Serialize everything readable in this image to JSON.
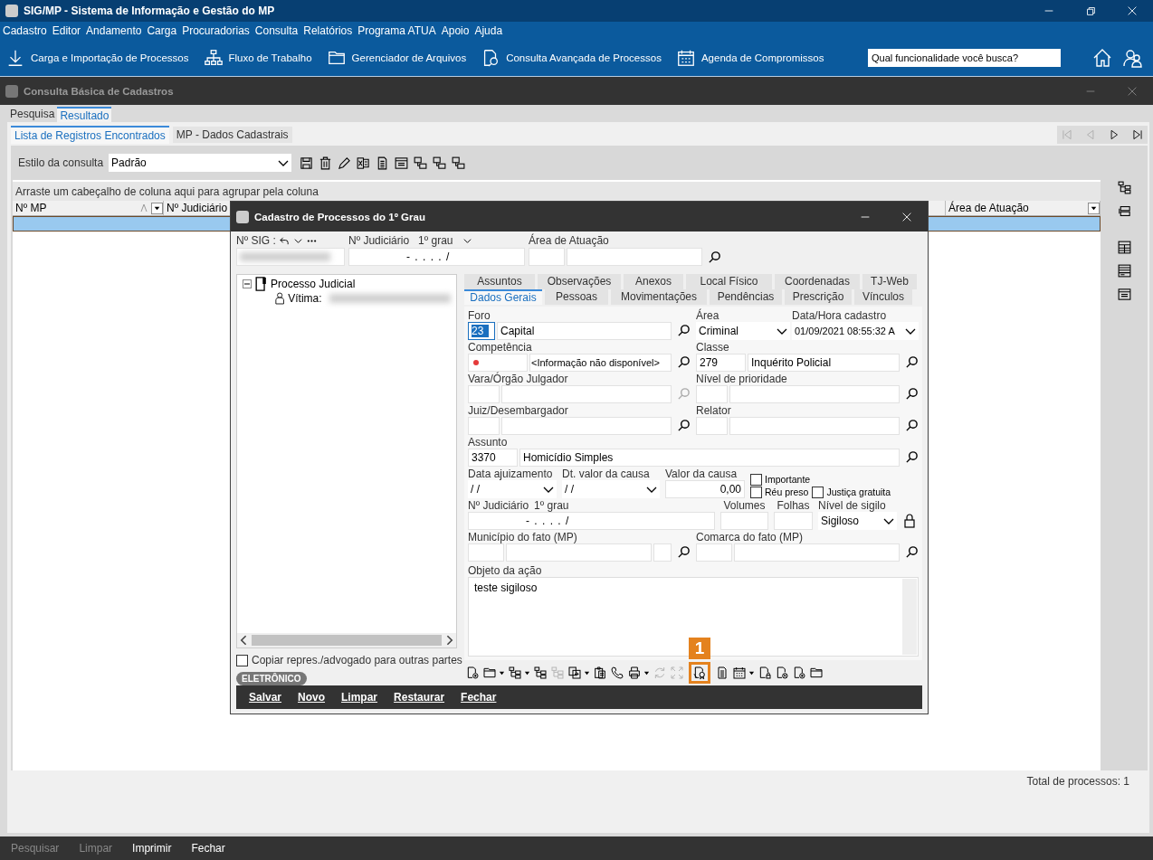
{
  "app": {
    "title": "SIG/MP - Sistema de Informação e Gestão do MP"
  },
  "menu": [
    "Cadastro",
    "Editor",
    "Andamento",
    "Carga",
    "Procuradorias",
    "Consulta",
    "Relatórios",
    "Programa ATUA",
    "Apoio",
    "Ajuda"
  ],
  "toolbar": [
    {
      "kind": "download",
      "label": "Carga e Importação de Processos"
    },
    {
      "kind": "orgchart",
      "label": "Fluxo de Trabalho"
    },
    {
      "kind": "folder",
      "label": "Gerenciador de Arquivos"
    },
    {
      "kind": "docsearch",
      "label": "Consulta Avançada de Processos"
    },
    {
      "kind": "calendar",
      "label": "Agenda de Compromissos"
    }
  ],
  "search": {
    "placeholder": "Qual funcionalidade você busca?"
  },
  "child_window": {
    "title": "Consulta Básica de Cadastros"
  },
  "tabs": [
    {
      "label": "Pesquisa",
      "selected": false
    },
    {
      "label": "Resultado",
      "selected": true
    }
  ],
  "subtabs": [
    {
      "label": "Lista de Registros Encontrados",
      "selected": true
    },
    {
      "label": "MP - Dados Cadastrais",
      "selected": false
    }
  ],
  "pager": [
    {
      "kind": "first",
      "disabled": true
    },
    {
      "kind": "prev",
      "disabled": true
    },
    {
      "kind": "next",
      "disabled": false
    },
    {
      "kind": "last",
      "disabled": false
    }
  ],
  "query_style": {
    "label": "Estilo da consulta",
    "value": "Padrão"
  },
  "style_tools": [
    {
      "kind": "save"
    },
    {
      "kind": "trash"
    },
    {
      "kind": "pencil"
    },
    {
      "kind": "sheet"
    },
    {
      "kind": "doc"
    },
    {
      "kind": "window"
    },
    {
      "kind": "network"
    },
    {
      "kind": "network"
    },
    {
      "kind": "network"
    }
  ],
  "group_hint": "Arraste um cabeçalho de coluna aqui para agrupar pela coluna",
  "columns": [
    {
      "label": "Nº MP",
      "sorted": true,
      "filter": true
    },
    {
      "label": "Nº Judiciário"
    },
    {
      "label": "Área de Atuação",
      "sorted": false,
      "filter": true
    }
  ],
  "grid_rows": [
    {
      "selected": true
    }
  ],
  "side_tools": [
    {
      "kind": "tree"
    },
    {
      "kind": "layers"
    },
    {
      "kind": "table"
    },
    {
      "kind": "list"
    },
    {
      "kind": "window"
    }
  ],
  "total": "Total de processos: 1",
  "bottom_actions": [
    {
      "label": "Pesquisar",
      "disabled": true
    },
    {
      "label": "Limpar",
      "disabled": true
    },
    {
      "label": "Imprimir",
      "disabled": false
    },
    {
      "label": "Fechar",
      "disabled": false
    }
  ],
  "dialog": {
    "title": "Cadastro de Processos do 1º Grau",
    "sig_label": "Nº SIG :",
    "jud_label": "Nº Judiciário",
    "jud_grade": "1º grau",
    "jud_value": "- .  . . .  /",
    "area_label": "Área de Atuação",
    "tree": [
      {
        "label": "Processo Judicial",
        "expanded": true,
        "children": [
          {
            "label": "Vítima:"
          }
        ]
      }
    ],
    "copy_option": {
      "label": "Copiar repres./advogado para outras partes",
      "checked": false
    },
    "badge": "ELETRÔNICO",
    "tabs_top": [
      {
        "label": "Assuntos"
      },
      {
        "label": "Observações"
      },
      {
        "label": "Anexos"
      },
      {
        "label": "Local Físico"
      },
      {
        "label": "Coordenadas"
      },
      {
        "label": "TJ-Web"
      }
    ],
    "tabs": [
      {
        "label": "Dados Gerais",
        "selected": true
      },
      {
        "label": "Pessoas",
        "selected": false
      },
      {
        "label": "Movimentações",
        "selected": false
      },
      {
        "label": "Pendências",
        "selected": false
      },
      {
        "label": "Prescrição",
        "selected": false
      },
      {
        "label": "Vínculos",
        "selected": false
      }
    ],
    "form": {
      "foro": {
        "label": "Foro",
        "code": "23",
        "name": "Capital"
      },
      "area": {
        "label": "Área",
        "value": "Criminal"
      },
      "created": {
        "label": "Data/Hora cadastro",
        "value": "01/09/2021 08:55:32 A"
      },
      "competencia": {
        "label": "Competência",
        "name": "<Informação não disponível>"
      },
      "classe": {
        "label": "Classe",
        "code": "279",
        "name": "Inquérito Policial"
      },
      "vara": {
        "label": "Vara/Órgão Julgador",
        "lookup_enabled": false
      },
      "prioridade": {
        "label": "Nível de prioridade",
        "lookup_enabled": true
      },
      "juiz": {
        "label": "Juiz/Desembargador",
        "lookup_enabled": true
      },
      "relator": {
        "label": "Relator",
        "lookup_enabled": true
      },
      "assunto": {
        "label": "Assunto",
        "code": "3370",
        "name": "Homicídio Simples"
      },
      "data_ajuizamento": {
        "label": "Data ajuizamento",
        "value": "/ /"
      },
      "dt_valor": {
        "label": "Dt. valor da causa",
        "value": "/ /"
      },
      "valor": {
        "label": "Valor da causa",
        "value": "0,00"
      },
      "flags": [
        {
          "label": "Importante",
          "checked": false
        },
        {
          "label": "Réu preso",
          "checked": false
        },
        {
          "label": "Justiça gratuita",
          "checked": false
        }
      ],
      "jud1": {
        "label": "Nº Judiciário",
        "grade": "1º grau",
        "value": "- .  . . .  /"
      },
      "volumes": {
        "label": "Volumes"
      },
      "folhas": {
        "label": "Folhas"
      },
      "sigilo": {
        "label": "Nível de sigilo",
        "value": "Sigiloso"
      },
      "municipio": {
        "label": "Município do fato (MP)"
      },
      "comarca": {
        "label": "Comarca do fato (MP)"
      },
      "objeto": {
        "label": "Objeto da ação",
        "value": "teste sigiloso"
      }
    },
    "tools": [
      {
        "kind": "docplus",
        "menu": false,
        "disabled": false
      },
      {
        "kind": "folder",
        "menu": true,
        "disabled": false
      },
      {
        "kind": "tree",
        "menu": true,
        "disabled": false
      },
      {
        "kind": "tree",
        "menu": false,
        "disabled": false
      },
      {
        "kind": "tree",
        "menu": false,
        "disabled": true
      },
      {
        "kind": "transfer",
        "menu": true,
        "disabled": false
      },
      {
        "kind": "clipboard",
        "menu": false,
        "disabled": false
      },
      {
        "kind": "phone",
        "menu": false,
        "disabled": false
      },
      {
        "kind": "printer",
        "menu": true,
        "disabled": false
      },
      {
        "kind": "refresh",
        "menu": false,
        "disabled": true
      },
      {
        "kind": "expand",
        "menu": false,
        "disabled": true
      },
      {
        "kind": "certificate",
        "menu": false,
        "disabled": false,
        "callout": "1"
      },
      {
        "kind": "doc",
        "menu": false,
        "disabled": false
      },
      {
        "kind": "calendar",
        "menu": true,
        "disabled": false
      },
      {
        "kind": "doclock",
        "menu": false,
        "disabled": false
      },
      {
        "kind": "docx",
        "menu": false,
        "disabled": false
      },
      {
        "kind": "docplus",
        "menu": false,
        "disabled": false
      },
      {
        "kind": "folder",
        "menu": false,
        "disabled": false
      }
    ],
    "actions": [
      "Salvar",
      "Novo",
      "Limpar",
      "Restaurar",
      "Fechar"
    ]
  }
}
